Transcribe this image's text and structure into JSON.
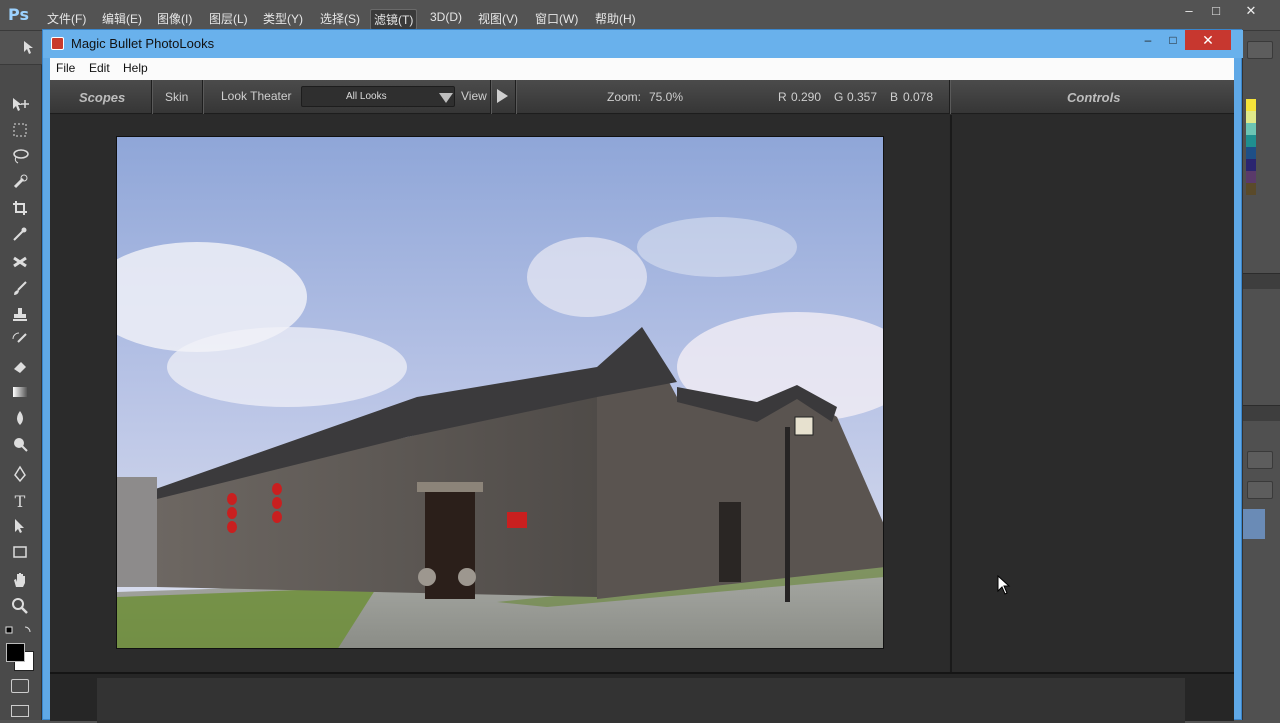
{
  "photoshop": {
    "logo": "Ps",
    "menu": [
      "文件(F)",
      "编辑(E)",
      "图像(I)",
      "图层(L)",
      "类型(Y)",
      "选择(S)",
      "滤镜(T)",
      "3D(D)",
      "视图(V)",
      "窗口(W)",
      "帮助(H)"
    ],
    "active_menu_index": 6,
    "window_buttons": {
      "minimize": "–",
      "maximize": "□",
      "close": "✕"
    },
    "tools": [
      "move-icon",
      "marquee-icon",
      "lasso-icon",
      "quick-select-icon",
      "crop-icon",
      "eyedropper-icon",
      "healing-icon",
      "brush-icon",
      "stamp-icon",
      "history-brush-icon",
      "eraser-icon",
      "gradient-icon",
      "blur-icon",
      "dodge-icon",
      "pen-icon",
      "type-icon",
      "path-select-icon",
      "shape-icon",
      "hand-icon",
      "zoom-icon"
    ],
    "type_tool_glyph": "T",
    "swatches": [
      "#f5e33a",
      "#dfe98a",
      "#6cc5b4",
      "#1f8f8f",
      "#1e4f87",
      "#2b2570",
      "#5a3a6a",
      "#5a4a2a"
    ]
  },
  "window": {
    "title": "Magic Bullet PhotoLooks",
    "minimize": "–",
    "maximize": "□",
    "close": "✕",
    "menu": [
      "File",
      "Edit",
      "Help"
    ]
  },
  "toolbar": {
    "scopes_tab": "Scopes",
    "skin_tab": "Skin",
    "look_theater": "Look Theater",
    "looks_select_value": "All Looks",
    "view_label": "View",
    "zoom_label": "Zoom:",
    "zoom_value": "75.0%",
    "r_label": "R",
    "r_value": "0.290",
    "g_label": "G",
    "g_value": "0.357",
    "b_label": "B",
    "b_value": "0.078",
    "controls_tab": "Controls"
  },
  "colors": {
    "title_bar": "#69b1ec",
    "close_button": "#c7372f",
    "toolbar": "#3f3f3f",
    "viewport": "#2b2b2b"
  }
}
